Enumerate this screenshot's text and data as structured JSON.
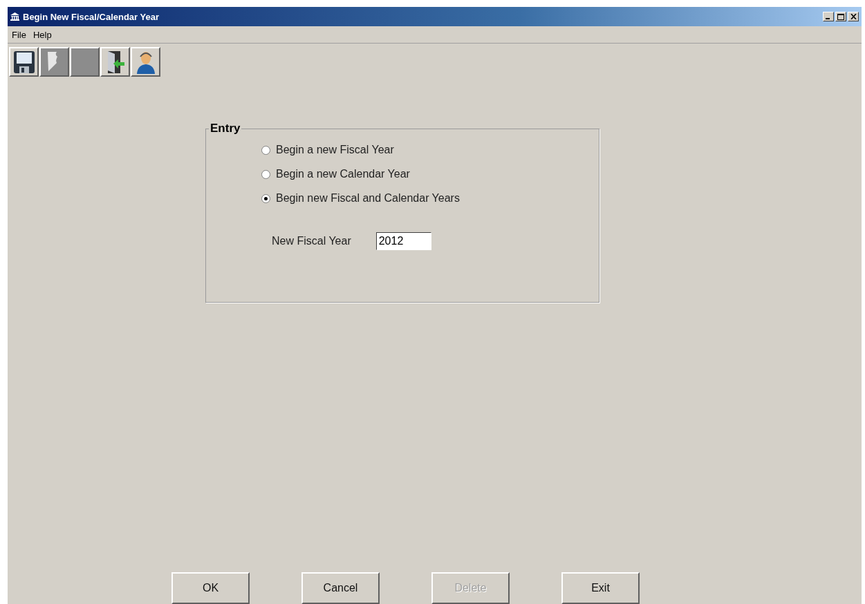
{
  "window": {
    "title": "Begin New Fiscal/Calendar Year"
  },
  "menu": [
    "File",
    "Help"
  ],
  "toolbar": [
    {
      "kind": "save",
      "disabled": false
    },
    {
      "kind": "page",
      "disabled": true
    },
    {
      "kind": "blank",
      "disabled": true
    },
    {
      "kind": "exit",
      "disabled": false
    },
    {
      "kind": "user",
      "disabled": false
    }
  ],
  "entry": {
    "title": "Entry",
    "options": [
      {
        "label": "Begin a new Fiscal Year",
        "selected": false
      },
      {
        "label": "Begin a new Calendar Year",
        "selected": false
      },
      {
        "label": "Begin new Fiscal and Calendar Years",
        "selected": true
      }
    ],
    "field": {
      "label": "New Fiscal Year",
      "value": "2012"
    }
  },
  "buttons": [
    {
      "label": "OK",
      "disabled": false
    },
    {
      "label": "Cancel",
      "disabled": false
    },
    {
      "label": "Delete",
      "disabled": true
    },
    {
      "label": "Exit",
      "disabled": false
    }
  ]
}
